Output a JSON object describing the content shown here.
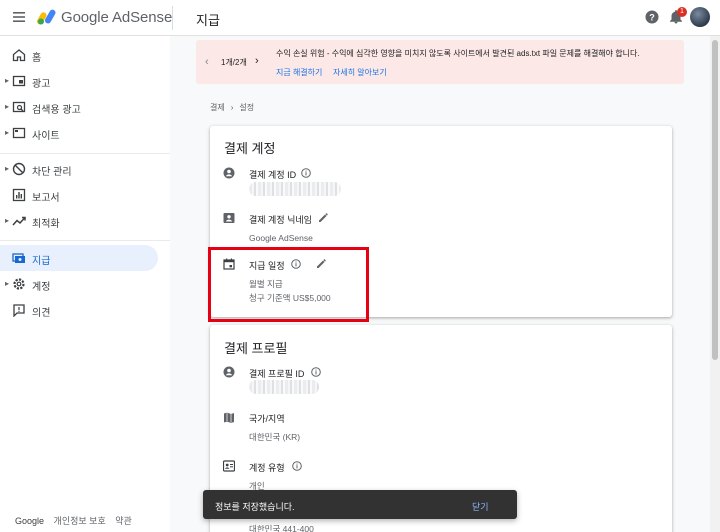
{
  "header": {
    "app_name": "Google AdSense",
    "page_title": "지급",
    "notification_count": "1"
  },
  "sidebar": {
    "items": [
      {
        "label": "홈",
        "icon": "home-icon"
      },
      {
        "label": "광고",
        "icon": "ads-icon"
      },
      {
        "label": "검색용 광고",
        "icon": "search-ads-icon"
      },
      {
        "label": "사이트",
        "icon": "sites-icon"
      },
      {
        "label": "차단 관리",
        "icon": "block-icon"
      },
      {
        "label": "보고서",
        "icon": "reports-icon"
      },
      {
        "label": "최적화",
        "icon": "optimization-icon"
      },
      {
        "label": "지급",
        "icon": "payments-icon"
      },
      {
        "label": "계정",
        "icon": "gear-icon"
      },
      {
        "label": "의견",
        "icon": "feedback-icon"
      }
    ],
    "footer": {
      "brand": "Google",
      "privacy": "개인정보 보호",
      "terms": "약관"
    }
  },
  "alert": {
    "pager": "1개/2개",
    "message": "수익 손실 위험 - 수익에 심각한 영향을 미치지 않도록 사이트에서 발견된 ads.txt 파일 문제를 해결해야 합니다.",
    "fix_link": "지금 해결하기",
    "learn_link": "자세히 알아보기"
  },
  "breadcrumb": {
    "parent": "결제",
    "current": "설정"
  },
  "payments_account": {
    "title": "결제 계정",
    "id_label": "결제 계정 ID",
    "nickname_label": "결제 계정 닉네임",
    "nickname_value": "Google AdSense",
    "schedule_label": "지급 일정",
    "schedule_value": "월별 지급",
    "threshold_value": "청구 기준액 US$5,000"
  },
  "payments_profile": {
    "title": "결제 프로필",
    "id_label": "결제 프로필 ID",
    "country_label": "국가/지역",
    "country_value": "대한민국 (KR)",
    "type_label": "계정 유형",
    "type_value": "개인",
    "partial_value": "대한민국 441-400"
  },
  "toast": {
    "message": "정보를 저장했습니다.",
    "action": "닫기"
  },
  "colors": {
    "accent": "#1a73e8",
    "alert_bg": "#fce8e6",
    "highlight": "#e60012",
    "active_nav_bg": "#e8f0fe"
  }
}
